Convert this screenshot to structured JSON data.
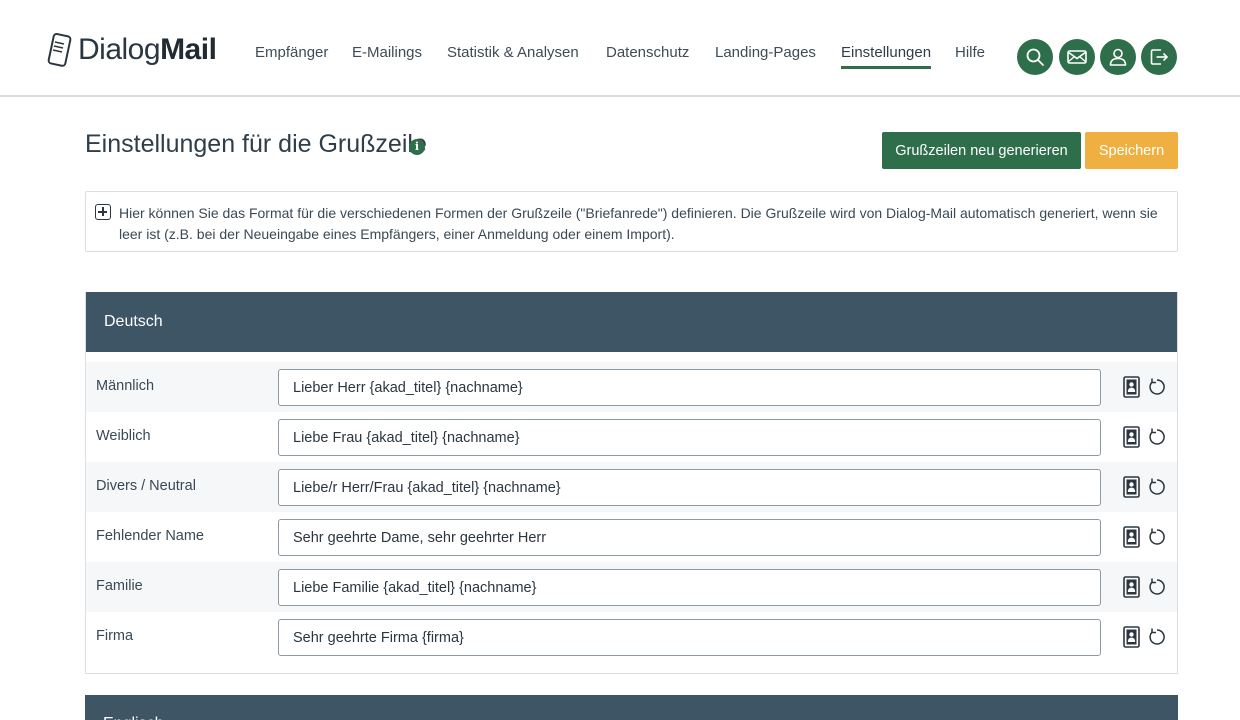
{
  "app": {
    "logo_regular": "Dialog",
    "logo_bold": "Mail"
  },
  "nav": [
    {
      "label": "Empfänger",
      "active": false
    },
    {
      "label": "E-Mailings",
      "active": false
    },
    {
      "label": "Statistik & Analysen",
      "active": false
    },
    {
      "label": "Datenschutz",
      "active": false
    },
    {
      "label": "Landing-Pages",
      "active": false
    },
    {
      "label": "Einstellungen",
      "active": true
    },
    {
      "label": "Hilfe",
      "active": false
    }
  ],
  "header_icons": [
    "search-icon",
    "mail-icon",
    "user-icon",
    "logout-icon"
  ],
  "page": {
    "title": "Einstellungen für die Grußzeile",
    "info_icon": "i",
    "regenerate_label": "Grußzeilen neu generieren",
    "save_label": "Speichern"
  },
  "notice": {
    "text": "Hier können Sie das Format für die verschiedenen Formen der Grußzeile (\"Briefanrede\") definieren. Die Grußzeile wird von Dialog-Mail automatisch generiert, wenn sie leer ist (z.B. bei der Neueingabe eines Empfängers, einer Anmeldung oder einem Import)."
  },
  "sections": [
    {
      "title": "Deutsch",
      "rows": [
        {
          "label": "Männlich",
          "value": "Lieber Herr {akad_titel} {nachname}"
        },
        {
          "label": "Weiblich",
          "value": "Liebe Frau {akad_titel} {nachname}"
        },
        {
          "label": "Divers / Neutral",
          "value": "Liebe/r Herr/Frau {akad_titel} {nachname}"
        },
        {
          "label": "Fehlender Name",
          "value": "Sehr geehrte Dame, sehr geehrter Herr"
        },
        {
          "label": "Familie",
          "value": "Liebe Familie {akad_titel} {nachname}"
        },
        {
          "label": "Firma",
          "value": "Sehr geehrte Firma {firma}"
        }
      ]
    },
    {
      "title": "Englisch"
    }
  ],
  "colors": {
    "primary_green": "#2f6e4a",
    "save_orange": "#f0b041",
    "section_header": "#3d5564"
  }
}
